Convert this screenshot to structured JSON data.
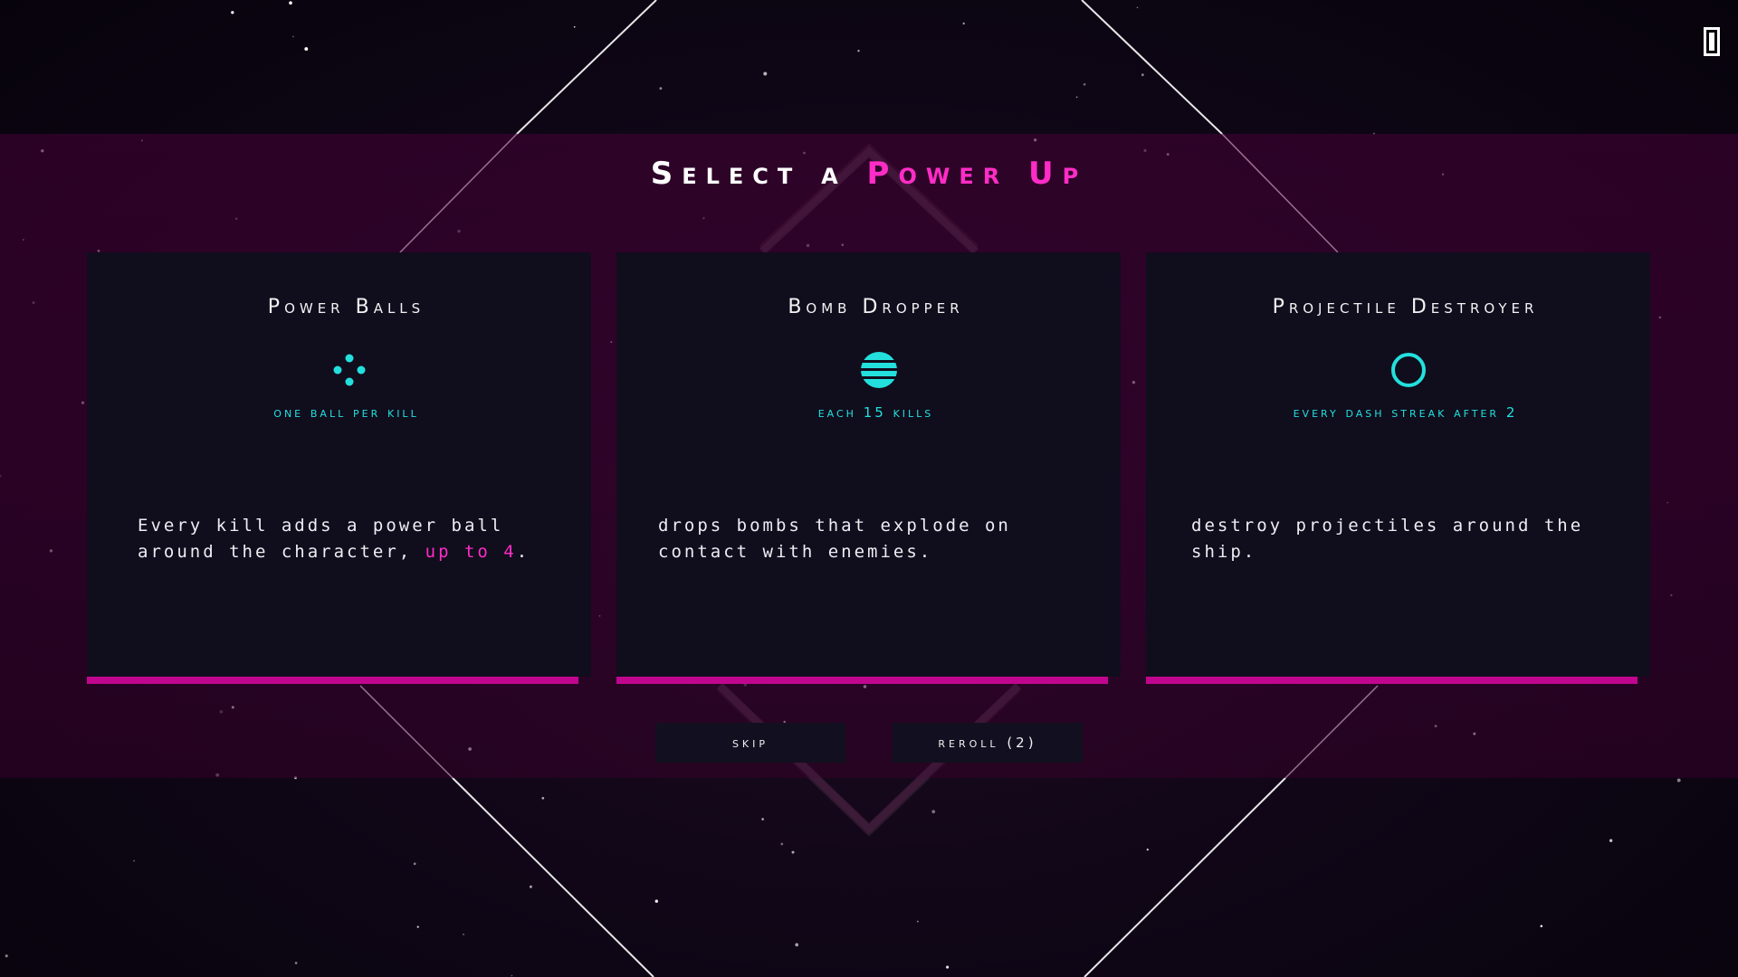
{
  "title": {
    "prefix": "Select a",
    "accent": "Power Up"
  },
  "cards": [
    {
      "name": "Power Balls",
      "icon": "four-dots-icon",
      "trigger": "one ball per kill",
      "desc_text": "Every kill adds a power ball around the character, ",
      "desc_highlight": "up to 4",
      "desc_end": "."
    },
    {
      "name": "Bomb Dropper",
      "icon": "striped-bomb-icon",
      "trigger": "each 15 kills",
      "desc_text": "drops bombs that explode on contact with enemies.",
      "desc_highlight": "",
      "desc_end": ""
    },
    {
      "name": "Projectile Destroyer",
      "icon": "ring-icon",
      "trigger": "every dash streak after 2",
      "desc_text": "destroy projectiles around the ship.",
      "desc_highlight": "",
      "desc_end": ""
    }
  ],
  "buttons": {
    "skip": "skip",
    "reroll": "reroll (2)"
  },
  "hud": {
    "pause_icon": "pause-bar-icon"
  },
  "colors": {
    "accent_magenta": "#ff2cc6",
    "card_border": "#c0068e",
    "accent_cyan": "#23e0dd",
    "card_bg": "#100d1d",
    "band_bg": "#3c0030"
  }
}
